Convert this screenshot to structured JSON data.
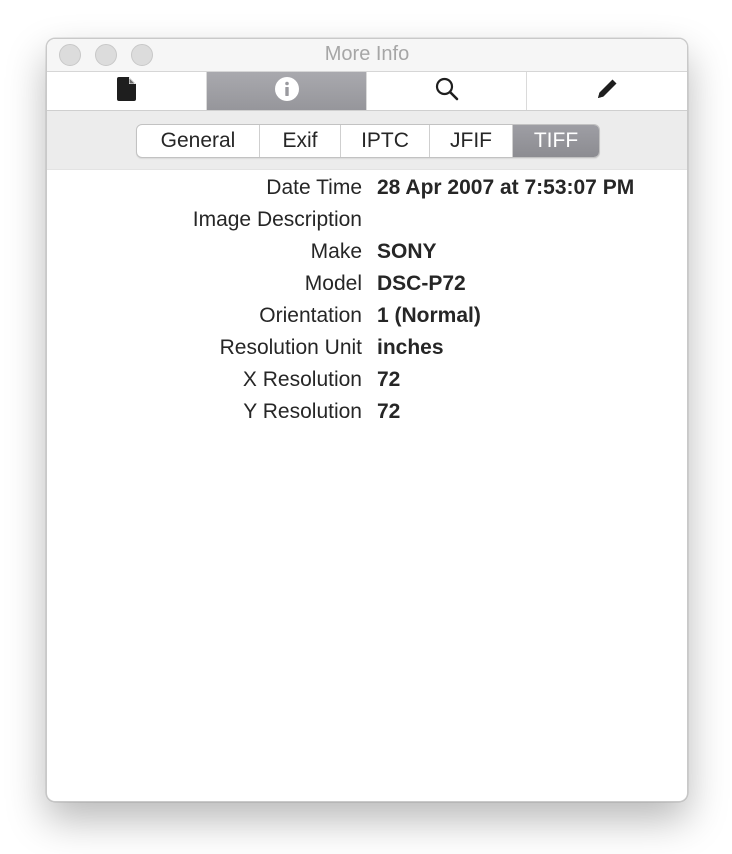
{
  "window": {
    "title": "More Info"
  },
  "toolbar": {
    "tabs": [
      {
        "icon": "document-icon",
        "active": false
      },
      {
        "icon": "info-icon",
        "active": true
      },
      {
        "icon": "search-icon",
        "active": false
      },
      {
        "icon": "pencil-icon",
        "active": false
      }
    ]
  },
  "segments": {
    "items": [
      {
        "label": "General"
      },
      {
        "label": "Exif"
      },
      {
        "label": "IPTC"
      },
      {
        "label": "JFIF"
      },
      {
        "label": "TIFF"
      }
    ],
    "selected": "TIFF"
  },
  "properties": [
    {
      "label": "Date Time",
      "value": "28 Apr 2007 at 7:53:07 PM"
    },
    {
      "label": "Image Description",
      "value": ""
    },
    {
      "label": "Make",
      "value": "SONY"
    },
    {
      "label": "Model",
      "value": "DSC-P72"
    },
    {
      "label": "Orientation",
      "value": "1 (Normal)"
    },
    {
      "label": "Resolution Unit",
      "value": "inches"
    },
    {
      "label": "X Resolution",
      "value": "72"
    },
    {
      "label": "Y Resolution",
      "value": "72"
    }
  ],
  "colors": {
    "active_tab": "#9a9a9f",
    "window_bg": "#ffffff",
    "segment_bar_bg": "#ececec"
  }
}
